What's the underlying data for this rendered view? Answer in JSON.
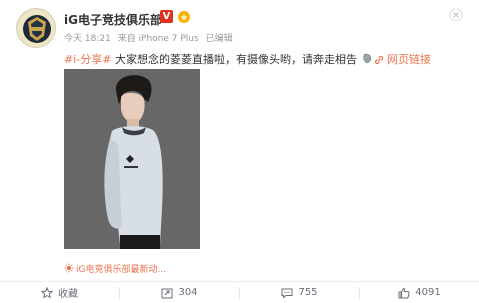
{
  "account": {
    "name": "iG电子竞技俱乐部",
    "verified_badge": "V"
  },
  "meta": {
    "time": "今天 18:21",
    "source": "来自 iPhone 7 Plus",
    "edited": "已编辑"
  },
  "post": {
    "hashtag": "#i-分享#",
    "text": "大家想念的菱菱直播啦，有摄像头哟，请奔走相告",
    "weblink": "网页链接"
  },
  "source_link": "iG电竞俱乐部最新动...",
  "actions": {
    "favorite": "收藏",
    "repost": "304",
    "comment": "755",
    "like": "4091"
  },
  "colors": {
    "accent": "#eb7350",
    "verified": "#e0301e",
    "meta": "#999999",
    "icon": "#696e78"
  }
}
